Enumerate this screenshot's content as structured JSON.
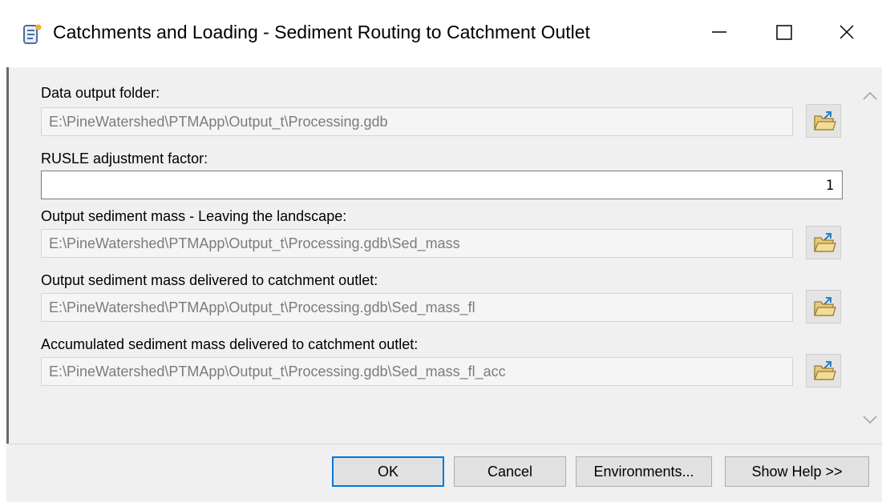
{
  "window": {
    "title": "Catchments and Loading - Sediment Routing to Catchment Outlet",
    "icon": "script-scroll-icon"
  },
  "form": {
    "data_output_folder": {
      "label": "Data output folder:",
      "value": "E:\\PineWatershed\\PTMApp\\Output_t\\Processing.gdb"
    },
    "rusle_factor": {
      "label": "RUSLE adjustment factor:",
      "value": "1"
    },
    "sed_mass": {
      "label": "Output sediment mass - Leaving the landscape:",
      "value": "E:\\PineWatershed\\PTMApp\\Output_t\\Processing.gdb\\Sed_mass"
    },
    "sed_mass_fl": {
      "label": "Output sediment mass delivered to catchment outlet:",
      "value": "E:\\PineWatershed\\PTMApp\\Output_t\\Processing.gdb\\Sed_mass_fl"
    },
    "sed_mass_fl_acc": {
      "label": "Accumulated sediment mass delivered to catchment outlet:",
      "value": "E:\\PineWatershed\\PTMApp\\Output_t\\Processing.gdb\\Sed_mass_fl_acc"
    }
  },
  "buttons": {
    "ok": "OK",
    "cancel": "Cancel",
    "environments": "Environments...",
    "show_help": "Show Help >>"
  },
  "colors": {
    "accent": "#0078d7",
    "panel": "#f0f0f0"
  }
}
